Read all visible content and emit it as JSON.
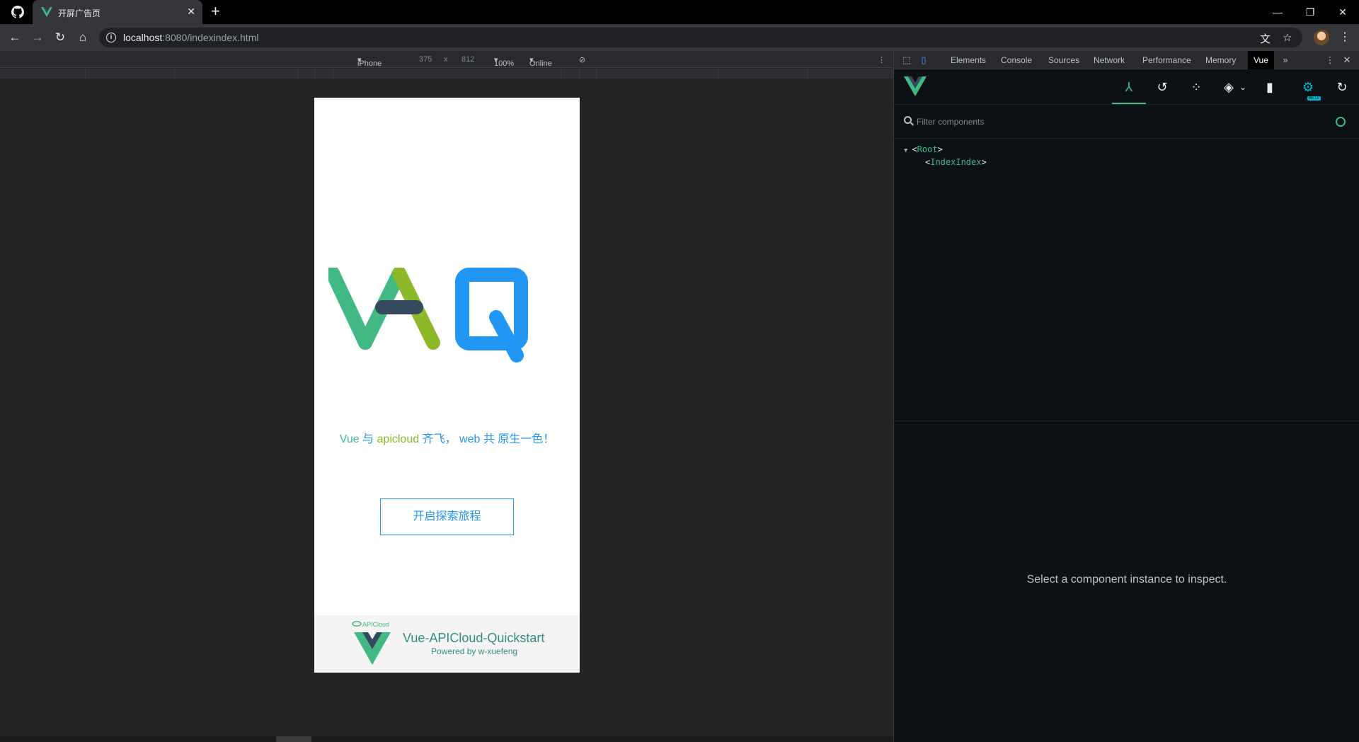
{
  "browser": {
    "tab": {
      "title": "开屏广告页"
    },
    "url": {
      "host": "localhost",
      "path": ":8080/indexindex.html"
    }
  },
  "device_toolbar": {
    "device": "iPhone X",
    "width": "375",
    "times": "x",
    "height": "812",
    "zoom": "100%",
    "network": "Online"
  },
  "app": {
    "slogan": {
      "part1": "Vue",
      "part2": " 与 ",
      "part3": "apicloud",
      "part4": " 齐飞， web 共 原生一色！"
    },
    "start_button": "开启探索旅程",
    "footer": {
      "brand_small": "APICloud",
      "title": "Vue-APICloud-Quickstart",
      "subtitle": "Powered by w-xuefeng"
    },
    "colors": {
      "green": "#42b983",
      "olive": "#8cb82a",
      "blue": "#2196f3",
      "navy": "#35495e"
    }
  },
  "devtools": {
    "tabs": [
      "Elements",
      "Console",
      "Sources",
      "Network",
      "Performance",
      "Memory",
      "Vue"
    ],
    "active_tab": "Vue",
    "vue": {
      "beta_badge": "BETA",
      "filter_placeholder": "Filter components",
      "tree": {
        "root": "Root",
        "child": "IndexIndex"
      },
      "inspect_message": "Select a component instance to inspect."
    }
  }
}
